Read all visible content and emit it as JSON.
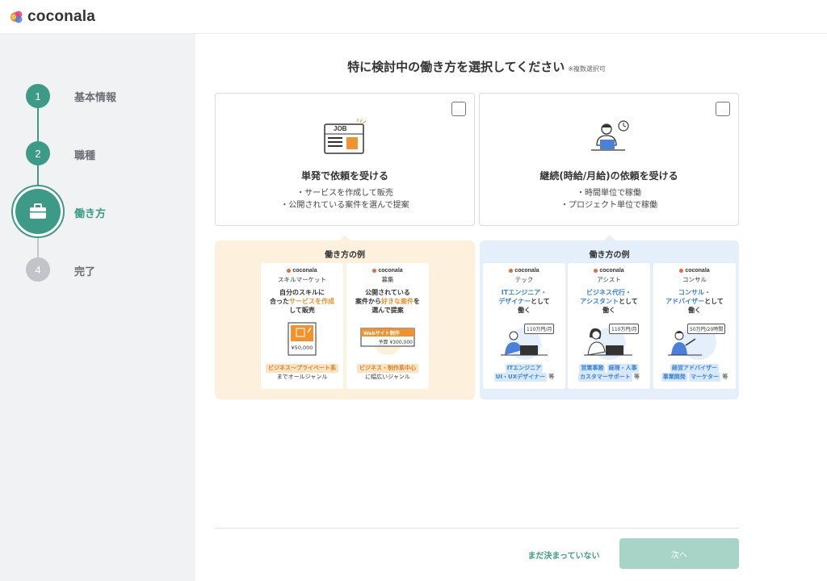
{
  "header": {
    "logo_text": "coconala"
  },
  "sidebar": {
    "steps": [
      {
        "number": "1",
        "label": "基本情報"
      },
      {
        "number": "2",
        "label": "職種"
      },
      {
        "number": "",
        "label": "働き方",
        "icon": "briefcase-icon"
      },
      {
        "number": "4",
        "label": "完了"
      }
    ]
  },
  "main": {
    "title": "特に検討中の働き方を選択してください",
    "title_note": "※複数選択可",
    "options": [
      {
        "title": "単発で依頼を受ける",
        "desc": [
          "・サービスを作成して販売",
          "・公開されている案件を選んで提案"
        ],
        "illus_label": "JOB"
      },
      {
        "title": "継続(時給/月給)の依頼を受ける",
        "desc": [
          "・時間単位で稼働",
          "・プロジェクト単位で稼働"
        ]
      }
    ],
    "examples_left": {
      "title": "働き方の例",
      "cards": [
        {
          "brand": "coconala",
          "sub": "スキルマーケット",
          "head_1": "自分のスキルに",
          "head_2a": "合った",
          "head_2b": "サービスを作成",
          "head_3": "して販売",
          "price": "¥50,000",
          "tag": "ビジネス〜プライベート系",
          "foot": "までオールジャンル"
        },
        {
          "brand": "coconala",
          "sub": "募集",
          "head_1": "公開されている",
          "head_2a": "案件から",
          "head_2b": "好きな案件",
          "head_2c": "を",
          "head_3": "選んで提案",
          "badge": "Webサイト制作",
          "price": "予算 ¥300,000",
          "tag": "ビジネス・制作系中心",
          "foot": "に幅広いジャンル"
        }
      ]
    },
    "examples_right": {
      "title": "働き方の例",
      "cards": [
        {
          "brand": "coconala",
          "sub": "テック",
          "head_1": "ITエンジニア・",
          "head_2a": "デザイナー",
          "head_2b": "として",
          "head_3": "働く",
          "price": "110万円/月",
          "tag_1": "ITエンジニア",
          "tag_2": "UI・UXデザイナー",
          "suffix": "等"
        },
        {
          "brand": "coconala",
          "sub": "アシスト",
          "head_1": "ビジネス代行・",
          "head_2a": "アシスタント",
          "head_2b": "として",
          "head_3": "働く",
          "price": "110万円/月",
          "tag_1a": "営業事務",
          "tag_1b": "経理・人事",
          "tag_2": "カスタマーサポート",
          "suffix": "等"
        },
        {
          "brand": "coconala",
          "sub": "コンサル",
          "head_1": "コンサル・",
          "head_2a": "アドバイザー",
          "head_2b": "として",
          "head_3": "働く",
          "price": "50万円/20時間",
          "tag_1": "経営アドバイザー",
          "tag_2a": "事業開発",
          "tag_2b": "マーケター",
          "suffix": "等"
        }
      ]
    }
  },
  "footer": {
    "skip_label": "まだ決まっていない",
    "next_label": "次へ"
  },
  "colors": {
    "accent": "#3d9a86",
    "orange_bg": "#fdf1de",
    "blue_bg": "#e4effb",
    "next_disabled": "#a8d3c7"
  }
}
